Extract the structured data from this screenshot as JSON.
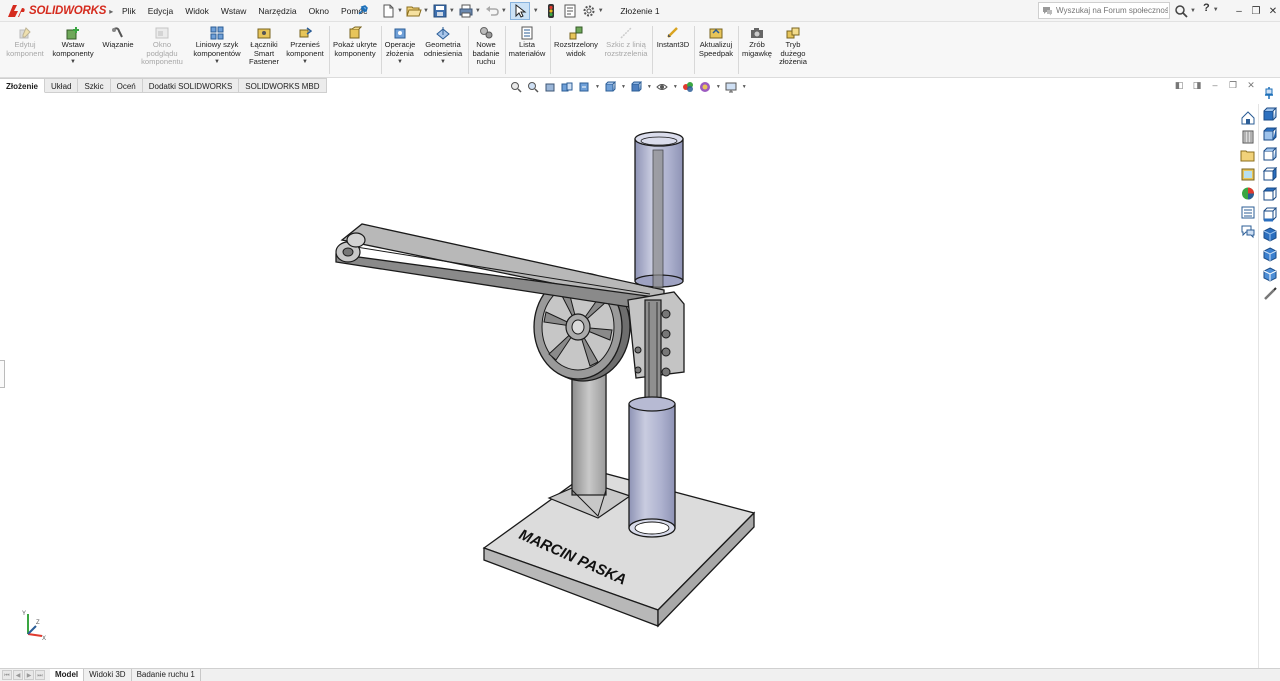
{
  "app": {
    "logo_text": "SOLIDWORKS",
    "document_title": "Złożenie 1"
  },
  "menu": [
    "Plik",
    "Edycja",
    "Widok",
    "Wstaw",
    "Narzędzia",
    "Okno",
    "Pomoc"
  ],
  "search": {
    "placeholder": "Wyszukaj na Forum społeczności"
  },
  "help": {
    "label": "?"
  },
  "ribbon": {
    "buttons": [
      {
        "label": "Edytuj\nkomponent",
        "enabled": false,
        "icon": "edit-component-icon"
      },
      {
        "label": "Wstaw\nkomponenty",
        "enabled": true,
        "icon": "insert-components-icon",
        "dropdown": true
      },
      {
        "label": "Wiązanie",
        "enabled": true,
        "icon": "mate-icon"
      },
      {
        "label": "Okno\npodglądu\nkomponentu",
        "enabled": false,
        "icon": "component-preview-icon"
      },
      {
        "label": "Liniowy szyk\nkomponentów",
        "enabled": true,
        "icon": "linear-pattern-icon",
        "dropdown": true
      },
      {
        "label": "Łączniki\nSmart\nFastener",
        "enabled": true,
        "icon": "smart-fasteners-icon"
      },
      {
        "label": "Przenieś\nkomponent",
        "enabled": true,
        "icon": "move-component-icon",
        "dropdown": true
      },
      {
        "label": "Pokaż ukryte\nkomponenty",
        "enabled": true,
        "icon": "show-hidden-icon"
      },
      {
        "label": "Operacje\nzłożenia",
        "enabled": true,
        "icon": "assembly-features-icon",
        "dropdown": true
      },
      {
        "label": "Geometria\nodniesienia",
        "enabled": true,
        "icon": "reference-geometry-icon",
        "dropdown": true
      },
      {
        "label": "Nowe\nbadanie\nruchu",
        "enabled": true,
        "icon": "new-motion-study-icon"
      },
      {
        "label": "Lista\nmateriałów",
        "enabled": true,
        "icon": "bill-of-materials-icon"
      },
      {
        "label": "Rozstrzelony\nwidok",
        "enabled": true,
        "icon": "exploded-view-icon"
      },
      {
        "label": "Szkic z linią\nrozstrzelenia",
        "enabled": false,
        "icon": "explode-line-sketch-icon"
      },
      {
        "label": "Instant3D",
        "enabled": true,
        "icon": "instant3d-icon"
      },
      {
        "label": "Aktualizuj\nSpeedpak",
        "enabled": true,
        "icon": "speedpak-icon"
      },
      {
        "label": "Zrób\nmigawkę",
        "enabled": true,
        "icon": "snapshot-icon"
      },
      {
        "label": "Tryb\ndużego\nzłożenia",
        "enabled": true,
        "icon": "large-assembly-icon"
      }
    ]
  },
  "command_tabs": [
    "Złożenie",
    "Układ",
    "Szkic",
    "Oceń",
    "Dodatki SOLIDWORKS",
    "SOLIDWORKS MBD"
  ],
  "active_command_tab": "Złożenie",
  "model": {
    "engraved_text": "MARCIN PASKA"
  },
  "triad": {
    "x_label": "X",
    "y_label": "Y",
    "z_label": "Z"
  },
  "bottom_tabs": [
    "Model",
    "Widoki 3D",
    "Badanie ruchu 1"
  ],
  "active_bottom_tab": "Model",
  "colors": {
    "brand_red": "#d52b1e",
    "accent_blue": "#1c6fb8",
    "part_gray": "#d2d2d2",
    "glass": "#b9bdd6"
  }
}
